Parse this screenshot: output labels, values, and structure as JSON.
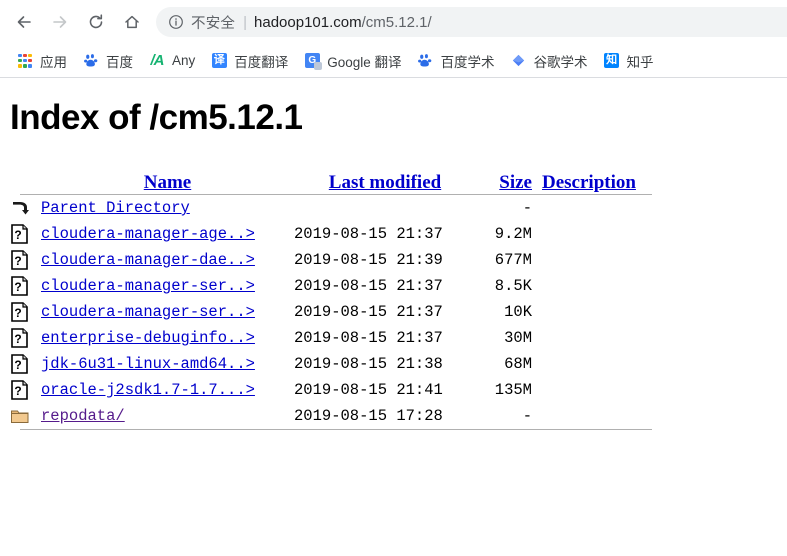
{
  "browser": {
    "nav": {
      "back": "back-arrow",
      "forward": "forward-arrow",
      "reload": "reload",
      "home": "home"
    },
    "omnibox": {
      "security_icon": "info-circle-icon",
      "security_label": "不安全",
      "separator": "|",
      "url_host": "hadoop101.com",
      "url_path": "/cm5.12.1/",
      "full_url": "hadoop101.com/cm5.12.1/"
    },
    "bookmarks": [
      {
        "icon": "apps-grid-icon",
        "label": "应用"
      },
      {
        "icon": "baidu-icon",
        "label": "百度"
      },
      {
        "icon": "any-icon",
        "label": "Any"
      },
      {
        "icon": "fanyi-icon",
        "label": "百度翻译"
      },
      {
        "icon": "google-translate-icon",
        "label": "Google 翻译"
      },
      {
        "icon": "baidu-icon",
        "label": "百度学术"
      },
      {
        "icon": "google-scholar-icon",
        "label": "谷歌学术"
      },
      {
        "icon": "zhihu-icon",
        "label": "知乎"
      }
    ]
  },
  "page": {
    "title": "Index of /cm5.12.1",
    "columns": {
      "name": "Name",
      "last_modified": "Last modified",
      "size": "Size",
      "description": "Description"
    },
    "rows": [
      {
        "icon": "parent-directory-icon",
        "name": "Parent Directory",
        "date": "",
        "size": "-",
        "description": "",
        "visited": false
      },
      {
        "icon": "unknown-file-icon",
        "name": "cloudera-manager-age..>",
        "date": "2019-08-15 21:37",
        "size": "9.2M",
        "description": "",
        "visited": false
      },
      {
        "icon": "unknown-file-icon",
        "name": "cloudera-manager-dae..>",
        "date": "2019-08-15 21:39",
        "size": "677M",
        "description": "",
        "visited": false
      },
      {
        "icon": "unknown-file-icon",
        "name": "cloudera-manager-ser..>",
        "date": "2019-08-15 21:37",
        "size": "8.5K",
        "description": "",
        "visited": false
      },
      {
        "icon": "unknown-file-icon",
        "name": "cloudera-manager-ser..>",
        "date": "2019-08-15 21:37",
        "size": "10K",
        "description": "",
        "visited": false
      },
      {
        "icon": "unknown-file-icon",
        "name": "enterprise-debuginfo..>",
        "date": "2019-08-15 21:37",
        "size": "30M",
        "description": "",
        "visited": false
      },
      {
        "icon": "unknown-file-icon",
        "name": "jdk-6u31-linux-amd64..>",
        "date": "2019-08-15 21:38",
        "size": "68M",
        "description": "",
        "visited": false
      },
      {
        "icon": "unknown-file-icon",
        "name": "oracle-j2sdk1.7-1.7...>",
        "date": "2019-08-15 21:41",
        "size": "135M",
        "description": "",
        "visited": false
      },
      {
        "icon": "folder-icon",
        "name": "repodata/",
        "date": "2019-08-15 17:28",
        "size": "-",
        "description": "",
        "visited": true
      }
    ]
  },
  "colors": {
    "link": "#0000cc",
    "visited_link": "#551a8b",
    "omnibox_bg": "#f1f3f4",
    "chrome_text": "#3c4043"
  }
}
